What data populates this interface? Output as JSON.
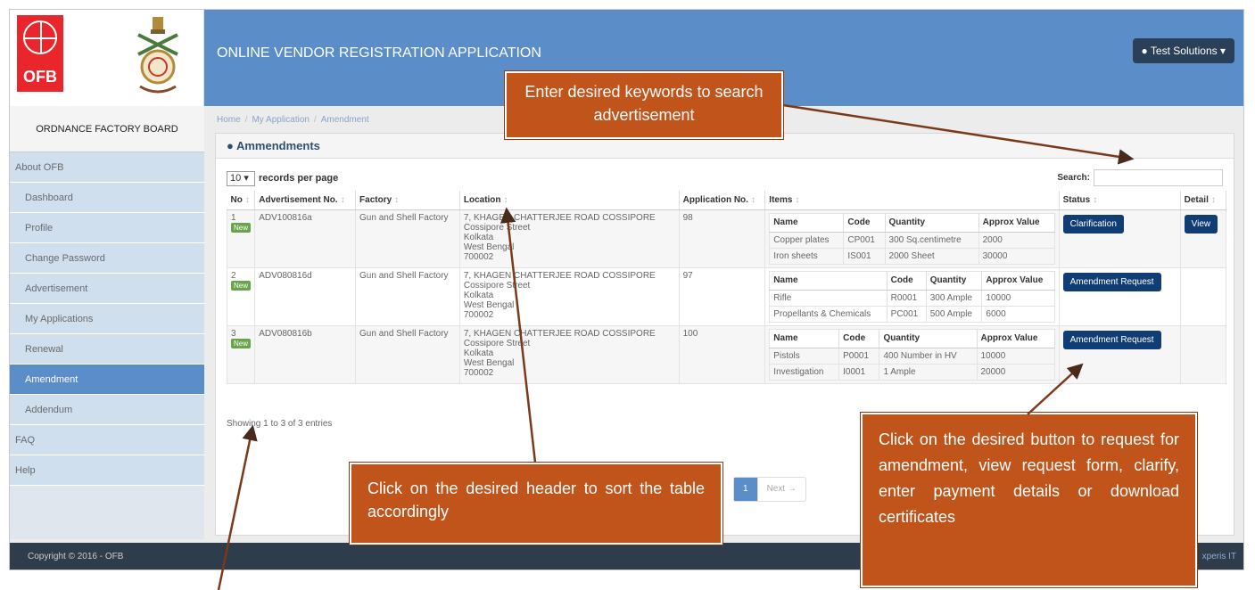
{
  "header": {
    "logo_text": "OFB",
    "app_title": "ONLINE VENDOR REGISTRATION APPLICATION",
    "user_label": "Test Solutions ▾"
  },
  "sidebar": {
    "title": "ORDNANCE FACTORY BOARD",
    "items": [
      {
        "label": "About OFB"
      },
      {
        "label": "Dashboard"
      },
      {
        "label": "Profile"
      },
      {
        "label": "Change Password"
      },
      {
        "label": "Advertisement"
      },
      {
        "label": "My Applications"
      },
      {
        "label": "Renewal"
      },
      {
        "label": "Amendment"
      },
      {
        "label": "Addendum"
      },
      {
        "label": "FAQ"
      },
      {
        "label": "Help"
      }
    ]
  },
  "breadcrumb": [
    "Home",
    "My Application",
    "Amendment"
  ],
  "panel": {
    "title": "Ammendments"
  },
  "table": {
    "length_value": "10",
    "length_suffix": "records per page",
    "search_label": "Search:",
    "headers": [
      "No",
      "Advertisement No.",
      "Factory",
      "Location",
      "Application No.",
      "Items",
      "Status",
      "Detail"
    ],
    "item_headers": [
      "Name",
      "Code",
      "Quantity",
      "Approx Value"
    ],
    "rows": [
      {
        "no": "1",
        "badge": "New",
        "adv": "ADV100816a",
        "factory": "Gun and Shell Factory",
        "location": [
          "7, KHAGEN CHATTERJEE ROAD COSSIPORE",
          "Cossipore Street",
          "Kolkata",
          "West Bengal",
          "700002"
        ],
        "app_no": "98",
        "items": [
          [
            "Copper plates",
            "CP001",
            "300 Sq.centimetre",
            "2000"
          ],
          [
            "Iron sheets",
            "IS001",
            "2000 Sheet",
            "30000"
          ]
        ],
        "status": "Clarification",
        "detail": "View"
      },
      {
        "no": "2",
        "badge": "New",
        "adv": "ADV080816d",
        "factory": "Gun and Shell Factory",
        "location": [
          "7, KHAGEN CHATTERJEE ROAD COSSIPORE",
          "Cossipore Street",
          "Kolkata",
          "West Bengal",
          "700002"
        ],
        "app_no": "97",
        "items": [
          [
            "Rifle",
            "R0001",
            "300 Ample",
            "10000"
          ],
          [
            "Propellants & Chemicals",
            "PC001",
            "500 Ample",
            "6000"
          ]
        ],
        "status": "Amendment Request",
        "detail": ""
      },
      {
        "no": "3",
        "badge": "New",
        "adv": "ADV080816b",
        "factory": "Gun and Shell Factory",
        "location": [
          "7, KHAGEN CHATTERJEE ROAD COSSIPORE",
          "Cossipore Street",
          "Kolkata",
          "West Bengal",
          "700002"
        ],
        "app_no": "100",
        "items": [
          [
            "Pistols",
            "P0001",
            "400 Number in HV",
            "10000"
          ],
          [
            "Investigation",
            "I0001",
            "1 Ample",
            "20000"
          ]
        ],
        "status": "Amendment Request",
        "detail": ""
      }
    ],
    "info": "Showing 1 to 3 of 3 entries",
    "pager": {
      "current": "1",
      "next": "Next →"
    }
  },
  "footer": {
    "copyright": "Copyright © 2016 - OFB",
    "credit": "xperis IT"
  },
  "callouts": {
    "search": "Enter desired keywords to search advertisement",
    "sort": "Click on the desired header to sort the table accordingly",
    "buttons": "Click on the desired button to request for amendment, view request form, clarify, enter payment details or download certificates"
  },
  "colors": {
    "header": "#5b8dc9",
    "callout": "#c0541b",
    "button": "#103d74",
    "arrow": "#7a3a1a"
  }
}
